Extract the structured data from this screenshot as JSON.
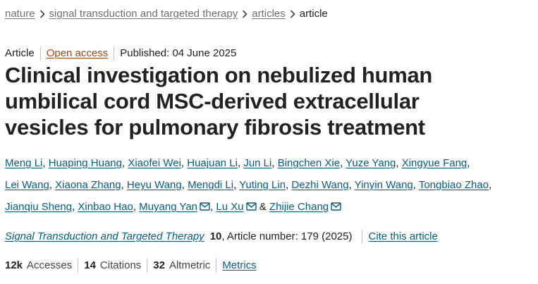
{
  "breadcrumb": {
    "items": [
      "nature",
      "signal transduction and targeted therapy",
      "articles"
    ],
    "current": "article"
  },
  "meta": {
    "type": "Article",
    "open_access": "Open access",
    "published": "Published: 04 June 2025"
  },
  "title": "Clinical investigation on nebulized human umbilical cord MSC-derived extracellular vesicles for pulmonary fibrosis treatment",
  "authors": [
    "Meng Li",
    "Huaping Huang",
    "Xiaofei Wei",
    "Huajuan Li",
    "Jun Li",
    "Bingchen Xie",
    "Yuze Yang",
    "Xingyue Fang",
    "Lei Wang",
    "Xiaona Zhang",
    "Heyu Wang",
    "Mengdi Li",
    "Yuting Lin",
    "Dezhi Wang",
    "Yinyin Wang",
    "Tongbiao Zhao",
    "Jianqiu Sheng",
    "Xinbao Hao",
    "Muyang Yan",
    "Lu Xu",
    "Zhijie Chang"
  ],
  "authors_connector": "&",
  "journal": {
    "name": "Signal Transduction and Targeted Therapy",
    "volume": "10",
    "article_number": ", Article number: 179 (2025)",
    "cite": "Cite this article"
  },
  "metrics": {
    "accesses_count": "12k",
    "accesses_label": "Accesses",
    "citations_count": "14",
    "citations_label": "Citations",
    "altmetric_count": "32",
    "altmetric_label": "Altmetric",
    "metrics_link": "Metrics"
  },
  "icons": {
    "breadcrumb_separator": "chevron-right-icon",
    "correspondence": "mail-icon"
  },
  "colors": {
    "link": "#025e8d",
    "open_access": "#b7410e",
    "breadcrumb_link": "#707070",
    "text": "#222222"
  }
}
